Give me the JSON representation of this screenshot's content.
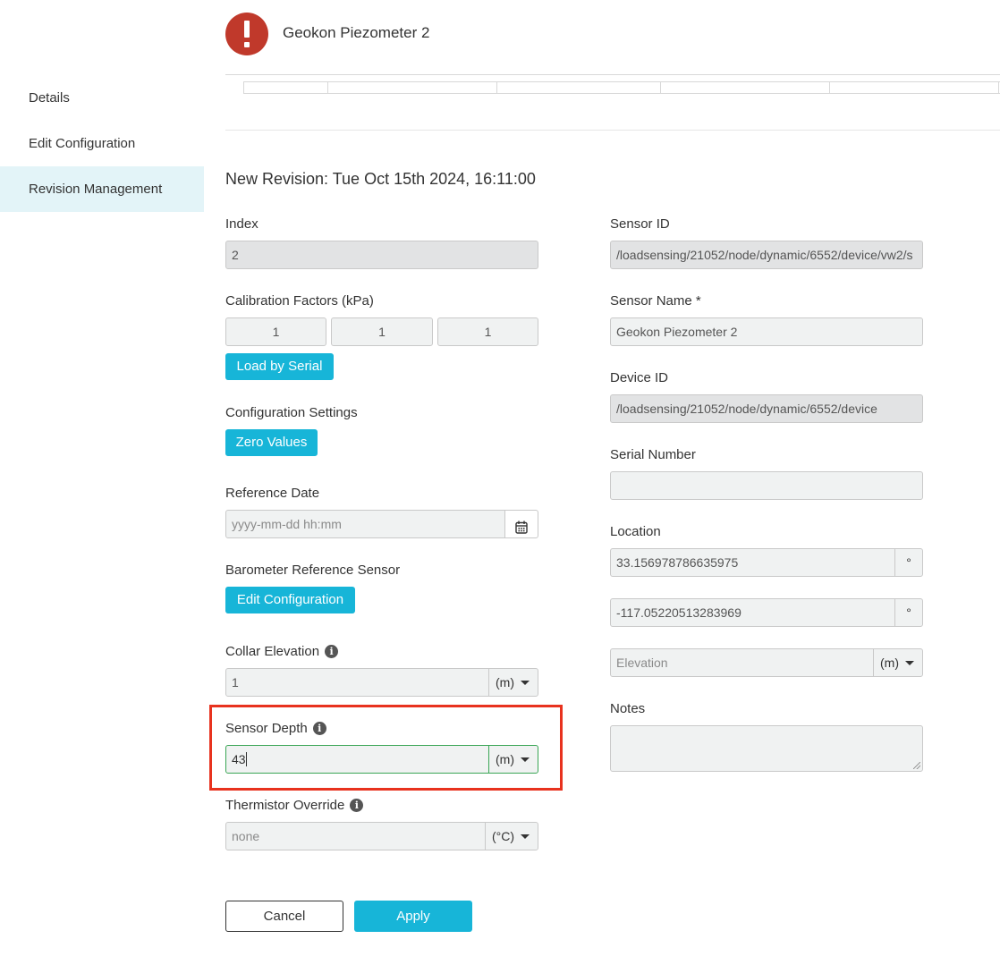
{
  "sidebar": {
    "items": [
      {
        "label": "Details"
      },
      {
        "label": "Edit Configuration"
      },
      {
        "label": "Revision Management"
      }
    ]
  },
  "header": {
    "title": "Geokon Piezometer 2",
    "status_icon": "alert-icon",
    "status_color": "#c0392b"
  },
  "revision": {
    "title": "New Revision: Tue Oct 15th 2024, 16:11:00"
  },
  "left": {
    "index": {
      "label": "Index",
      "value": "2"
    },
    "calibration": {
      "label": "Calibration Factors (kPa)",
      "values": [
        "1",
        "1",
        "1"
      ],
      "load_button": "Load by Serial"
    },
    "config_settings": {
      "label": "Configuration Settings",
      "button": "Zero Values"
    },
    "reference_date": {
      "label": "Reference Date",
      "placeholder": "yyyy-mm-dd hh:mm",
      "icon": "calendar-icon"
    },
    "barometer": {
      "label": "Barometer Reference Sensor",
      "button": "Edit Configuration"
    },
    "collar_elevation": {
      "label": "Collar Elevation",
      "value": "1",
      "unit": "(m)"
    },
    "sensor_depth": {
      "label": "Sensor Depth",
      "value": "43",
      "unit": "(m)"
    },
    "thermistor": {
      "label": "Thermistor Override",
      "placeholder": "none",
      "unit": "(°C)"
    }
  },
  "right": {
    "sensor_id": {
      "label": "Sensor ID",
      "value": "/loadsensing/21052/node/dynamic/6552/device/vw2/s"
    },
    "sensor_name": {
      "label": "Sensor Name *",
      "value": "Geokon Piezometer 2"
    },
    "device_id": {
      "label": "Device ID",
      "value": "/loadsensing/21052/node/dynamic/6552/device"
    },
    "serial_number": {
      "label": "Serial Number",
      "value": ""
    },
    "location": {
      "label": "Location",
      "latitude": "33.156978786635975",
      "longitude": "-117.05220513283969",
      "degree_unit": "°",
      "elevation_placeholder": "Elevation",
      "elevation_unit": "(m)"
    },
    "notes": {
      "label": "Notes"
    }
  },
  "actions": {
    "cancel": "Cancel",
    "apply": "Apply"
  },
  "colors": {
    "accent": "#17b5d8",
    "highlight": "#e8321e",
    "focus": "#3aa655"
  }
}
